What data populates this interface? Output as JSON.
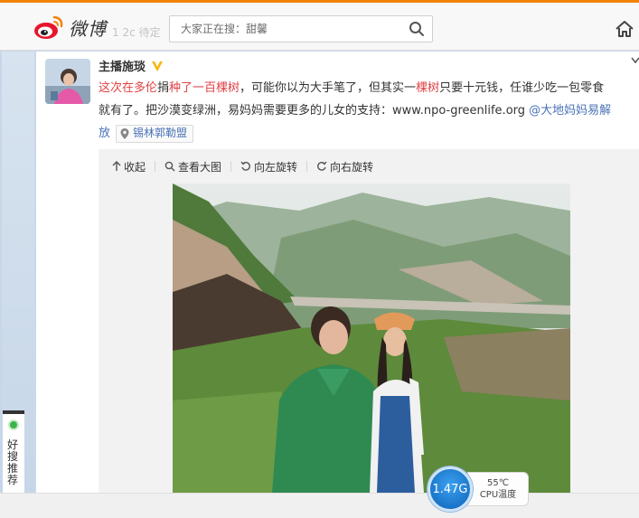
{
  "header": {
    "logo_text": "微博",
    "ghost_text": "1 2c 待定",
    "search_placeholder": "大家正在搜：甜馨",
    "icons": [
      "weibo-logo",
      "search-icon",
      "home-icon"
    ]
  },
  "sidebar": {
    "widget_label": "好搜推荐"
  },
  "post": {
    "author": "主播施琰",
    "verified_color": "#f7b500",
    "text_parts": {
      "p1": "这次在多伦",
      "p2": "捐",
      "p3": "种了一百棵树",
      "p4": "，可能你以为大手笔了，但其实一",
      "p5": "棵树",
      "p6": "只要十元钱，任谁少吃一包零食",
      "p7": "就有了。把沙漠变绿洲，易妈妈需要更多的儿女的支持：www.npo-greenlife.org ",
      "p8": "@大地妈妈易解",
      "p9": "放"
    },
    "location": "锡林郭勒盟",
    "accent_red": "#e14044",
    "accent_blue": "#4a72b6"
  },
  "media_toolbar": {
    "collapse": "收起",
    "view_large": "查看大图",
    "rotate_left": "向左旋转",
    "rotate_right": "向右旋转"
  },
  "speed_widget": {
    "value": "1.47G",
    "temp": "55℃",
    "label": "CPU温度"
  }
}
